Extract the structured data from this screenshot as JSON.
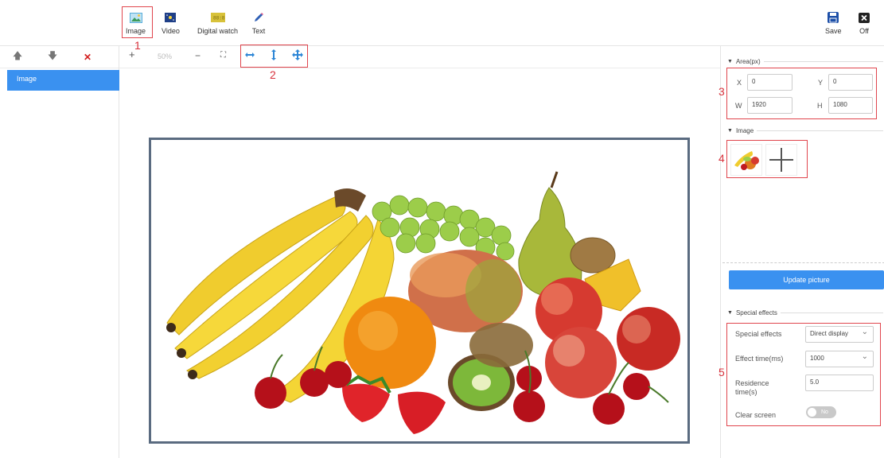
{
  "toolbar": {
    "items": [
      {
        "label": "Image",
        "icon": "image-icon"
      },
      {
        "label": "Video",
        "icon": "video-icon"
      },
      {
        "label": "Digital watch",
        "icon": "digital-watch-icon"
      },
      {
        "label": "Text",
        "icon": "text-pen-icon"
      }
    ],
    "save_label": "Save",
    "off_label": "Off"
  },
  "annotations": [
    "1",
    "2",
    "3",
    "4",
    "5"
  ],
  "layers": {
    "items": [
      {
        "label": "Image"
      }
    ]
  },
  "canvas_tools": {
    "zoom_in": "+",
    "zoom_level": "50%",
    "zoom_out": "−",
    "fit": "⛶"
  },
  "area": {
    "title": "Area(px)",
    "x_label": "X",
    "x_value": "0",
    "y_label": "Y",
    "y_value": "0",
    "w_label": "W",
    "w_value": "1920",
    "h_label": "H",
    "h_value": "1080"
  },
  "image_section": {
    "title": "Image"
  },
  "update_button": "Update picture",
  "effects": {
    "title": "Special effects",
    "effect_label": "Special effects",
    "effect_value": "Direct display",
    "time_label": "Effect time(ms)",
    "time_value": "1000",
    "residence_label": "Residence time(s)",
    "residence_value": "5.0",
    "clear_label": "Clear screen",
    "clear_value": "No"
  },
  "colors": {
    "accent": "#3a91f0",
    "annotation": "#e0454d",
    "frame": "#5a6b80"
  }
}
